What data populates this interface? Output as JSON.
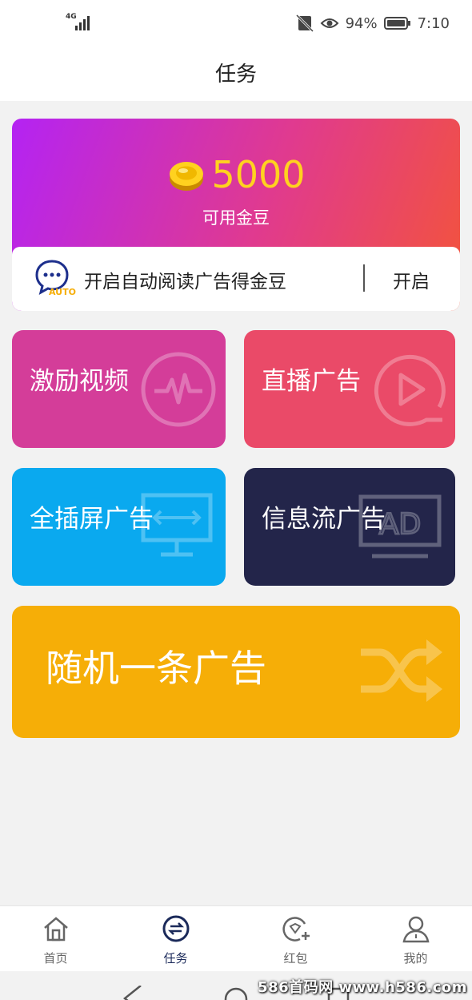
{
  "status_bar": {
    "network": "4G",
    "battery_percent": "94%",
    "time": "7:10"
  },
  "header": {
    "title": "任务"
  },
  "coins": {
    "value": "5000",
    "label": "可用金豆",
    "gradient": [
      "#b423f3",
      "#f3543a"
    ],
    "value_color": "#ffd21f"
  },
  "auto_read": {
    "icon_badge": "AUTO",
    "text": "开启自动阅读广告得金豆",
    "button": "开启"
  },
  "tiles": [
    {
      "label": "激励视频",
      "color": "#d43d99",
      "icon": "pulse-icon"
    },
    {
      "label": "直播广告",
      "color": "#ea4a68",
      "icon": "play-icon"
    },
    {
      "label": "全插屏广告",
      "color": "#0aa9ef",
      "icon": "monitor-icon"
    },
    {
      "label": "信息流广告",
      "color": "#23254a",
      "icon": "ad-monitor-icon"
    },
    {
      "label": "随机一条广告",
      "color": "#f6ae07",
      "icon": "shuffle-icon"
    }
  ],
  "tab_bar": {
    "active_color": "#1b2a5a",
    "items": [
      {
        "label": "首页",
        "icon": "home-icon"
      },
      {
        "label": "任务",
        "icon": "task-icon"
      },
      {
        "label": "红包",
        "icon": "red-packet-icon"
      },
      {
        "label": "我的",
        "icon": "user-icon"
      }
    ]
  },
  "watermark": "586首码网 www.h586.com"
}
